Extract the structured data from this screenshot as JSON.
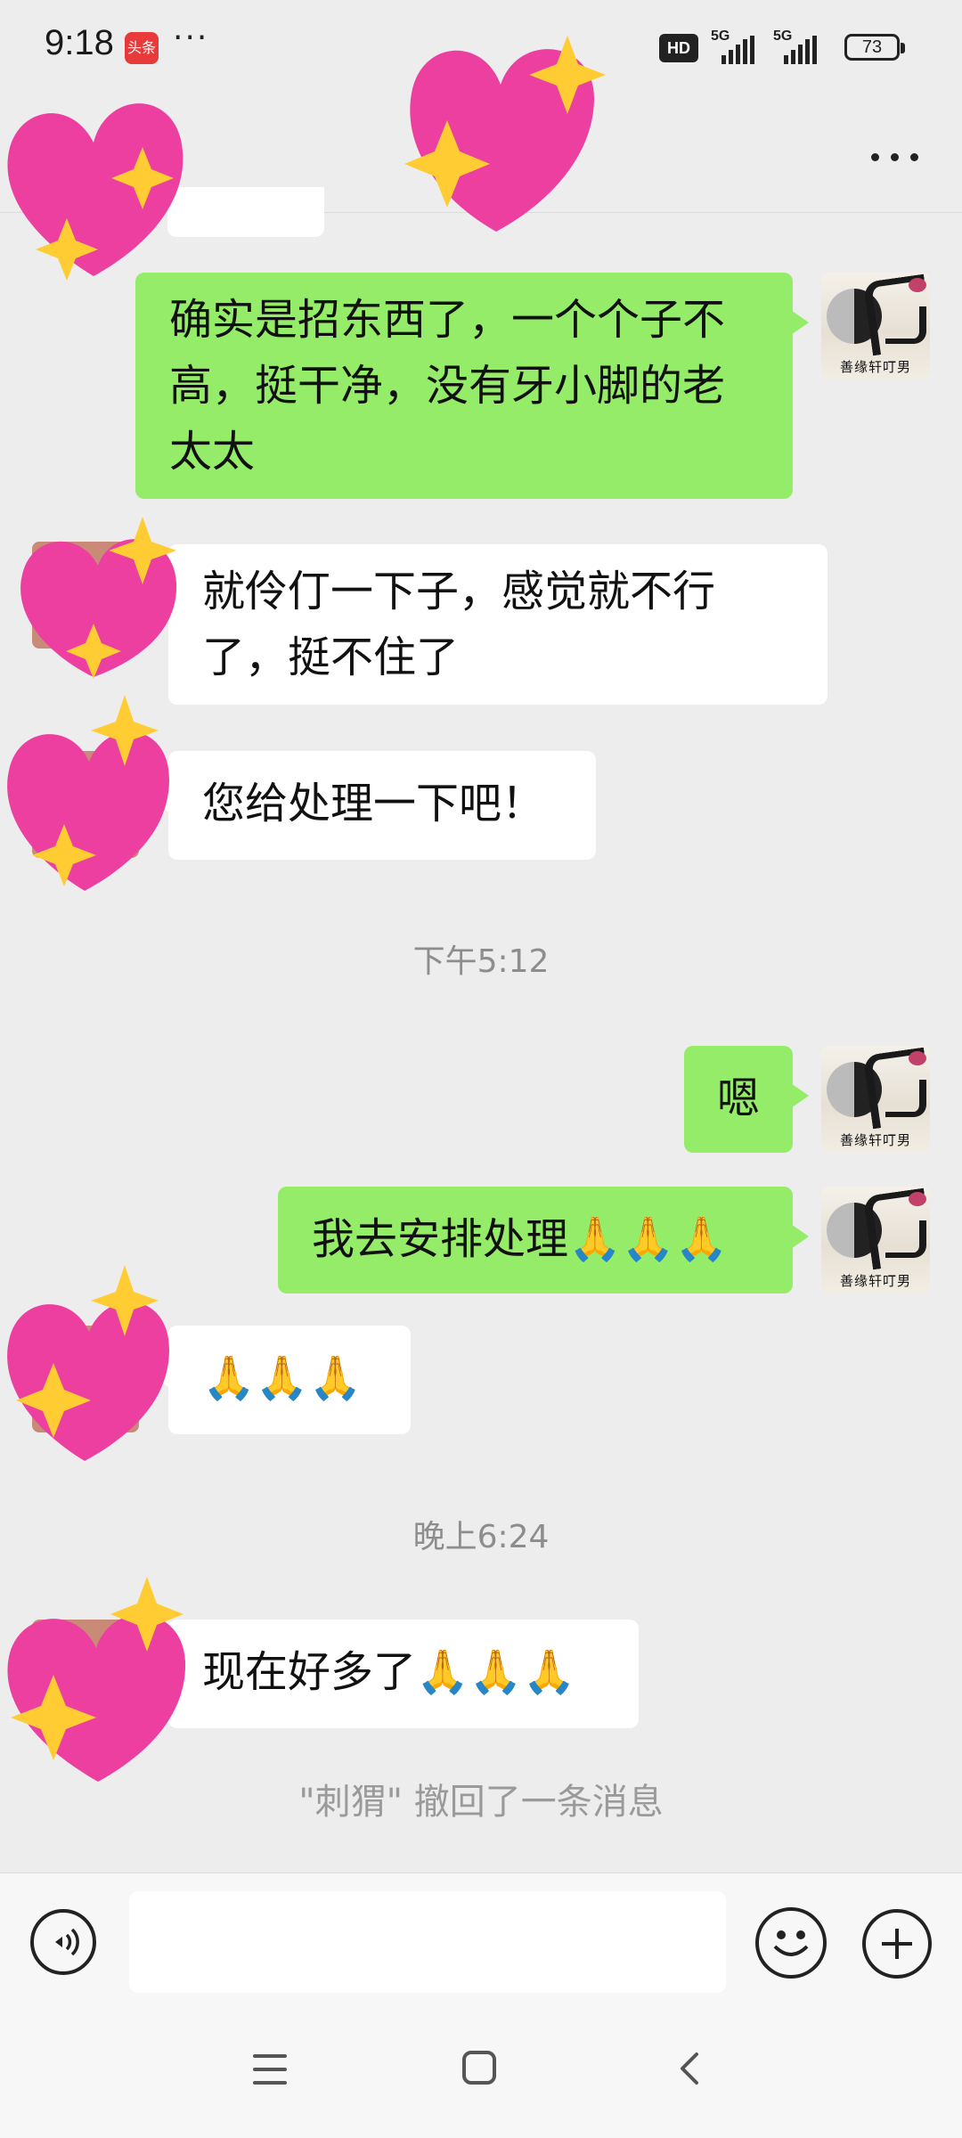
{
  "status_bar": {
    "time": "9:18",
    "app_badge": "头条",
    "more": "···",
    "hd": "HD",
    "network1": "5G",
    "network2": "5G",
    "battery": "73"
  },
  "messages": [
    {
      "side": "self",
      "text": "确实是招东西了，一个个子不高，挺干净，没有牙小脚的老太太"
    },
    {
      "side": "peer",
      "text": "就伶仃一下子，感觉就不行了，挺不住了"
    },
    {
      "side": "peer",
      "text": "您给处理一下吧！"
    },
    {
      "side": "time",
      "text": "下午5:12"
    },
    {
      "side": "self",
      "text": "嗯"
    },
    {
      "side": "self",
      "text": "我去安排处理🙏🙏🙏"
    },
    {
      "side": "peer",
      "text": "🙏🙏🙏"
    },
    {
      "side": "time",
      "text": "晚上6:24"
    },
    {
      "side": "peer",
      "text": "现在好多了🙏🙏🙏"
    }
  ],
  "recall_notice": "\"刺猬\" 撤回了一条消息",
  "self_avatar_caption": "善缘轩叮男",
  "colors": {
    "sent_bubble": "#95ec69",
    "received_bubble": "#ffffff",
    "background": "#ededed",
    "heart": "#f0489f",
    "sparkle": "#ffcc33"
  },
  "icons": {
    "voice": "voice-input-icon",
    "emoji": "smiley-icon",
    "plus": "plus-icon",
    "more": "more-dots-icon",
    "nav_menu": "menu-icon",
    "nav_home": "home-square-icon",
    "nav_back": "back-chevron-icon"
  }
}
